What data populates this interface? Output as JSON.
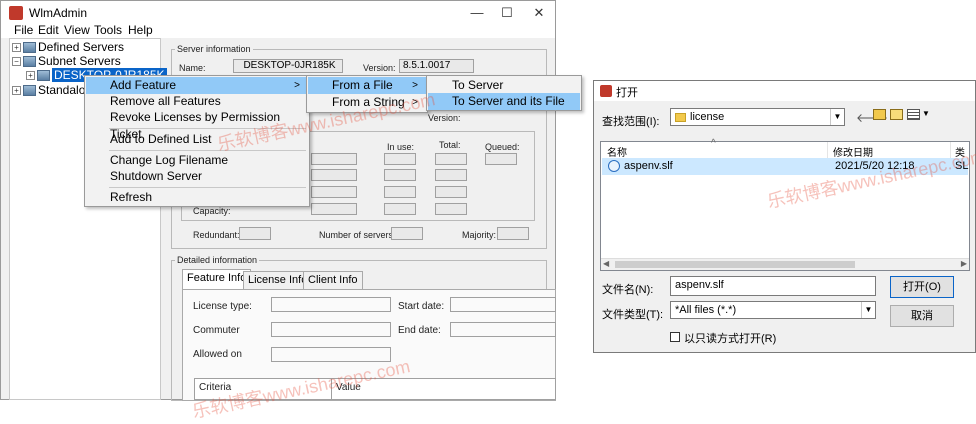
{
  "wlm": {
    "title": "WlmAdmin",
    "menu": [
      "File",
      "Edit",
      "View",
      "Tools",
      "Help"
    ],
    "window_controls": {
      "minimize": "—",
      "maximize": "☐",
      "close": "✕"
    },
    "tree": {
      "defined_servers": "Defined Servers",
      "subnet_servers": "Subnet Servers",
      "desktop": "DESKTOP-0JR185K",
      "standalone": "Standalone"
    },
    "server_info": {
      "title": "Server information",
      "name_label": "Name:",
      "name_value": "DESKTOP-0JR185K",
      "version_label": "Version:",
      "version_value": "8.5.1.0017",
      "version2_label": "Version:",
      "in_use": "In use:",
      "total": "Total:",
      "queued": "Queued:",
      "capacity": "Capacity:",
      "redundant": "Redundant:",
      "num_servers": "Number of servers:",
      "majority": "Majority:"
    },
    "detailed": {
      "title": "Detailed information",
      "tabs": [
        "Feature Info",
        "License Info",
        "Client Info"
      ],
      "license_type": "License type:",
      "start_date": "Start date:",
      "commuter": "Commuter",
      "end_date": "End date:",
      "allowed_on": "Allowed on",
      "criteria": "Criteria",
      "value": "Value"
    }
  },
  "context_menu": {
    "items": [
      "Add Feature",
      "Remove all Features",
      "Revoke Licenses by Permission Ticket",
      "Add to Defined List",
      "Change Log Filename",
      "Shutdown Server",
      "Refresh"
    ],
    "submenu1": [
      "From a File",
      "From a String"
    ],
    "submenu2": [
      "To Server",
      "To Server and its File"
    ]
  },
  "dialog": {
    "title": "打开",
    "lookin_label": "查找范围(I):",
    "lookin_value": "license",
    "col_name": "名称",
    "col_date": "修改日期",
    "col_type": "类",
    "file_name": "aspenv.slf",
    "file_date": "2021/5/20 12:18",
    "file_type_abbr": "SL",
    "filename_label": "文件名(N):",
    "filename_value": "aspenv.slf",
    "filetype_label": "文件类型(T):",
    "filetype_value": "*All files (*.*)",
    "readonly_label": "以只读方式打开(R)",
    "open_btn": "打开(O)",
    "cancel_btn": "取消"
  },
  "watermark": "乐软博客www.isharepc.com"
}
